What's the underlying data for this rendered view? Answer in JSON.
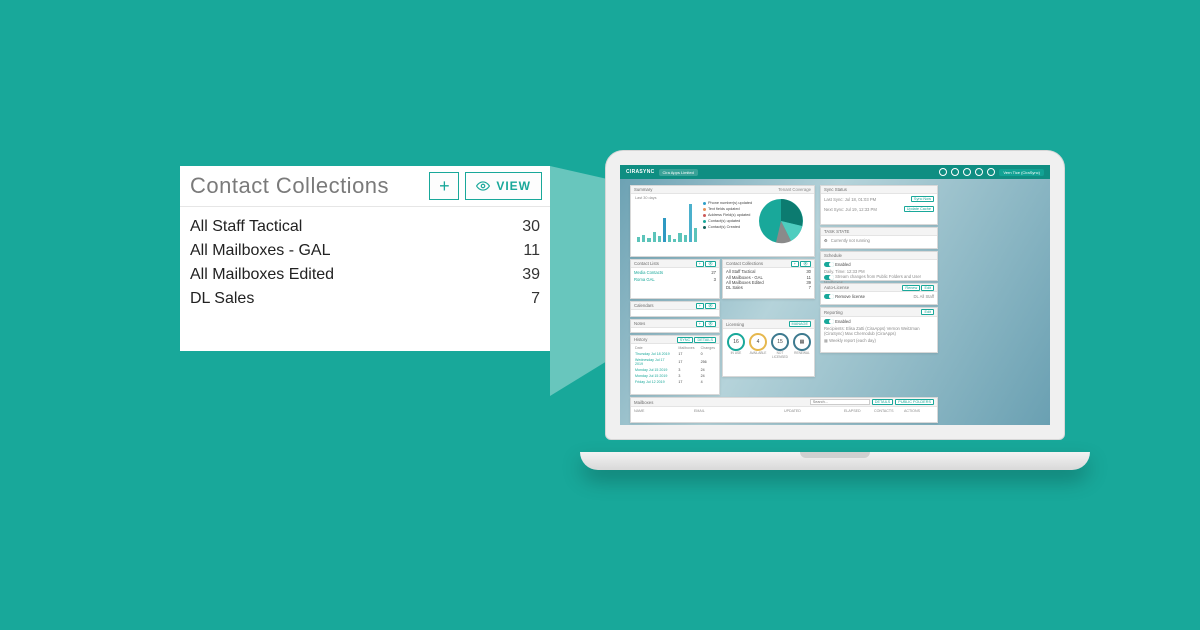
{
  "callout": {
    "title": "Contact Collections",
    "add_label": "+",
    "view_label": "VIEW",
    "items": [
      {
        "name": "All Staff Tactical",
        "count": 30
      },
      {
        "name": "All Mailboxes - GAL",
        "count": 11
      },
      {
        "name": "All Mailboxes Edited",
        "count": 39
      },
      {
        "name": "DL Sales",
        "count": 7
      }
    ]
  },
  "dashboard": {
    "brand": "CIRASYNC",
    "tenant": "Cira Apps Limited",
    "user": "Vern Tice (CiraSync)",
    "summary": {
      "title": "Summary",
      "subtitle": "Last 30 days",
      "coverage_label": "Tenant Coverage",
      "legend": [
        "Phone number(s) updated",
        "Text fields updated",
        "Address Field(s) updated",
        "Contact(s) updated",
        "Contact(s) Created"
      ]
    },
    "sync": {
      "title": "Sync Status",
      "last_sync": "Last Sync: Jul 18, 01:03 PM",
      "next_sync": "Next Sync: Jul 19, 12:33 PM",
      "sync_now": "Sync Now",
      "update_cache": "Update Cache"
    },
    "task": {
      "title": "TASK STATE",
      "state": "Currently not running"
    },
    "schedule": {
      "title": "Schedule",
      "enabled": "Enabled",
      "daily": "Daily. Time: 12:33 PM",
      "stream": "Stream changes from Public Folders and User Mailboxes"
    },
    "autolic": {
      "title": "Auto-License",
      "target": "DL All Staff",
      "renew": "Renew",
      "edit": "Edit",
      "remove": "Remove license"
    },
    "reporting": {
      "title": "Reporting",
      "enabled": "Enabled",
      "edit": "Edit",
      "recipients": "Recipients: Elisa Zatti (CiraApps) Vernon Weitzman (CiraSync) Max Chernodub (CiraApps)",
      "weekly": "Weekly report (each day)"
    },
    "contactlists": {
      "title": "Contact Lists",
      "items": [
        "Media Contacts",
        "Roma GAL"
      ],
      "counts": [
        27,
        3
      ]
    },
    "collections": {
      "title": "Contact Collections",
      "items": [
        "All Staff Tactical",
        "All Mailboxes - GAL",
        "All Mailboxes Edited",
        "DL Sales"
      ],
      "counts": [
        30,
        11,
        39,
        7
      ]
    },
    "calendars": {
      "title": "Calendars"
    },
    "notes": {
      "title": "Notes"
    },
    "history": {
      "title": "History",
      "cols": [
        "Date",
        "Mailboxes",
        "Changes"
      ],
      "filters": [
        "SYNC",
        "DETAILS"
      ],
      "rows": [
        [
          "Thursday Jul 18 2019",
          "17",
          "0"
        ],
        [
          "Wednesday Jul 17 2019",
          "17",
          "256"
        ],
        [
          "Monday Jul 15 2019",
          "3",
          "24"
        ],
        [
          "Monday Jul 15 2019",
          "3",
          "24"
        ],
        [
          "Friday Jul 12 2019",
          "17",
          "4"
        ]
      ]
    },
    "licensing": {
      "title": "Licensing",
      "manage": "MANAGE",
      "inuse": {
        "val": "16",
        "label": "IN USE"
      },
      "avail": {
        "val": "4",
        "label": "AVAILABLE"
      },
      "notlic": {
        "val": "15",
        "label": "NOT LICENSED"
      },
      "renewal": {
        "label": "RENEWAL"
      }
    },
    "mailboxes": {
      "title": "Mailboxes",
      "search_ph": "Search...",
      "details_btn": "DETAILS",
      "public_btn": "PUBLIC FOLDERS",
      "cols": [
        "NAME",
        "EMAIL",
        "UPDATED",
        "ELAPSED",
        "CONTACTS",
        "ACTIONS"
      ]
    }
  }
}
